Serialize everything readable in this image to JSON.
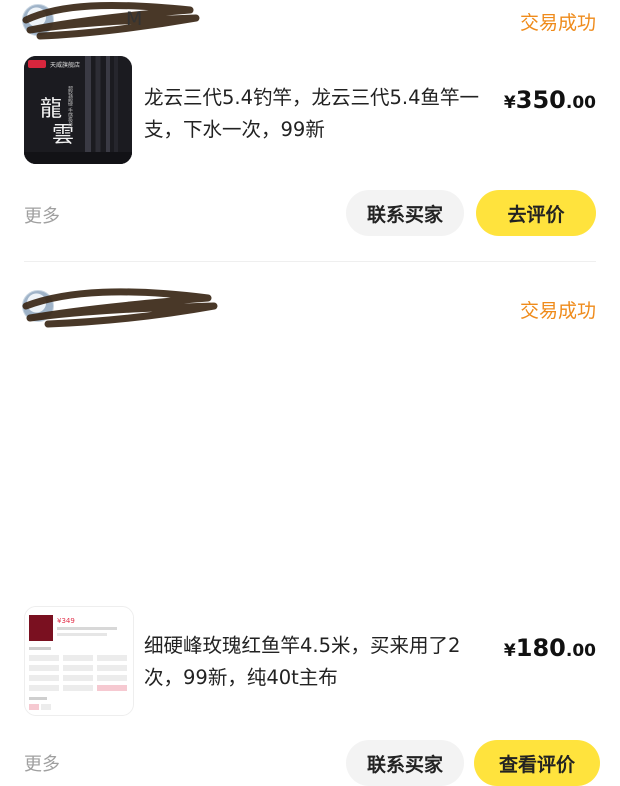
{
  "orders": [
    {
      "seller_name_visible": "M",
      "status": "交易成功",
      "thumb": {
        "badge": "天威旗舰店",
        "calligraphy": "龍雲",
        "side_caption": "超轻超硬 手感极佳"
      },
      "description": "龙云三代5.4钓竿，龙云三代5.4鱼竿一支，下水一次，99新",
      "price": {
        "currency": "¥",
        "integer": "350",
        "decimal": ".00"
      },
      "more_label": "更多",
      "contact_label": "联系买家",
      "action_label": "去评价"
    },
    {
      "seller_name_visible": "",
      "status": "交易成功",
      "thumb": {
        "price_text": "¥349"
      },
      "description": "细硬峰玫瑰红鱼竿4.5米，买来用了2次，99新，纯40t主布",
      "price": {
        "currency": "¥",
        "integer": "180",
        "decimal": ".00"
      },
      "more_label": "更多",
      "contact_label": "联系买家",
      "action_label": "查看评价"
    }
  ],
  "colors": {
    "status": "#ef8b1b",
    "primary_button": "#ffe33d",
    "secondary_button": "#f3f3f3",
    "more_text": "#a0a0a0"
  },
  "icons": [
    "avatar",
    "scribble-redaction"
  ]
}
